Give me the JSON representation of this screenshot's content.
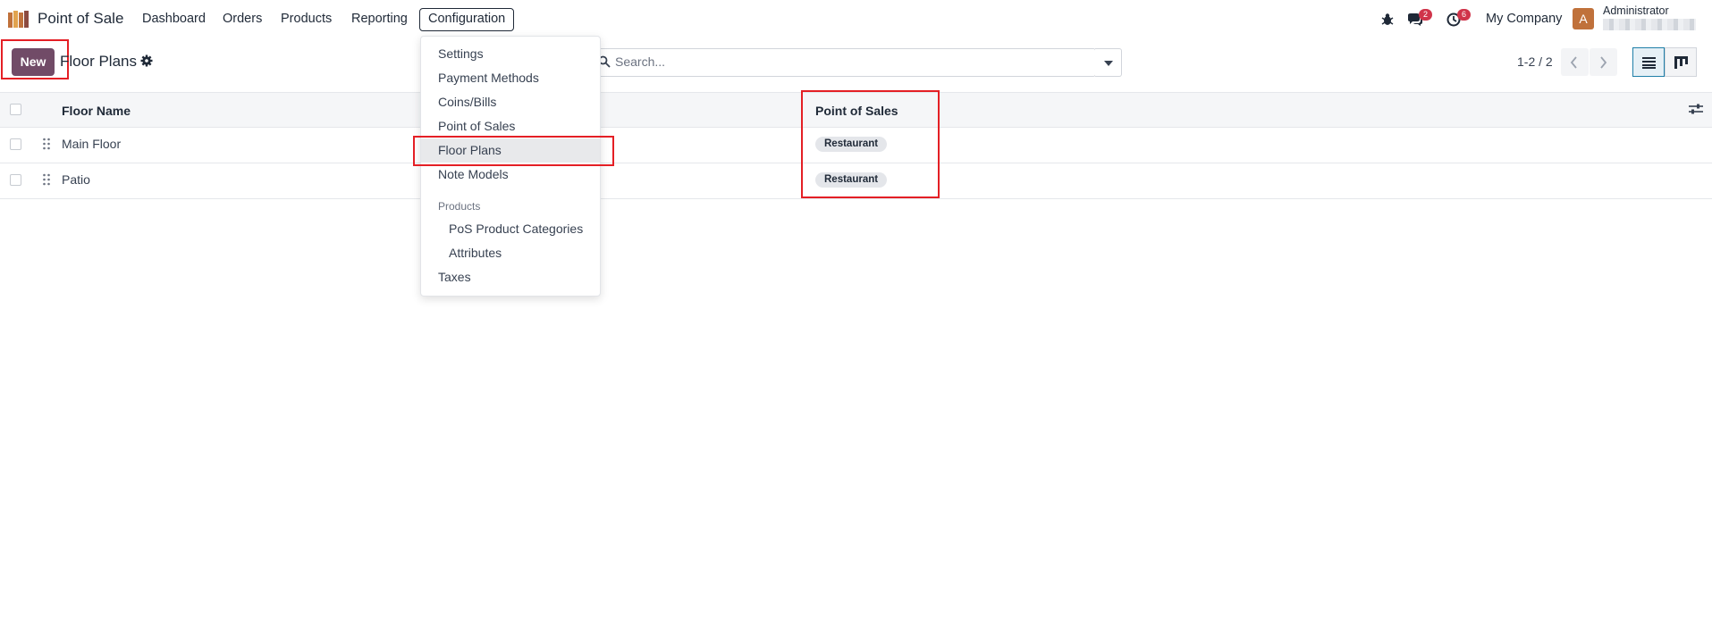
{
  "navbar": {
    "app_name": "Point of Sale",
    "menu": [
      "Dashboard",
      "Orders",
      "Products",
      "Reporting"
    ],
    "active_menu": "Configuration",
    "messages_badge": "2",
    "activities_badge": "6",
    "company": "My Company",
    "user_initial": "A",
    "user_name": "Administrator"
  },
  "control_panel": {
    "new_label": "New",
    "title": "Floor Plans",
    "search_placeholder": "Search...",
    "pager": "1-2 / 2"
  },
  "table": {
    "columns": [
      "Floor Name",
      "Point of Sales"
    ],
    "rows": [
      {
        "name": "Main Floor",
        "pos": "Restaurant"
      },
      {
        "name": "Patio",
        "pos": "Restaurant"
      }
    ]
  },
  "dropdown": {
    "items": [
      "Settings",
      "Payment Methods",
      "Coins/Bills",
      "Point of Sales",
      "Floor Plans",
      "Note Models"
    ],
    "active_item": "Floor Plans",
    "products_header": "Products",
    "product_items": [
      "PoS Product Categories",
      "Attributes"
    ],
    "taxes": "Taxes"
  },
  "colors": {
    "primary": "#714b67",
    "highlight": "#e41f25",
    "badge": "#d0344a",
    "avatar": "#c0713b"
  }
}
